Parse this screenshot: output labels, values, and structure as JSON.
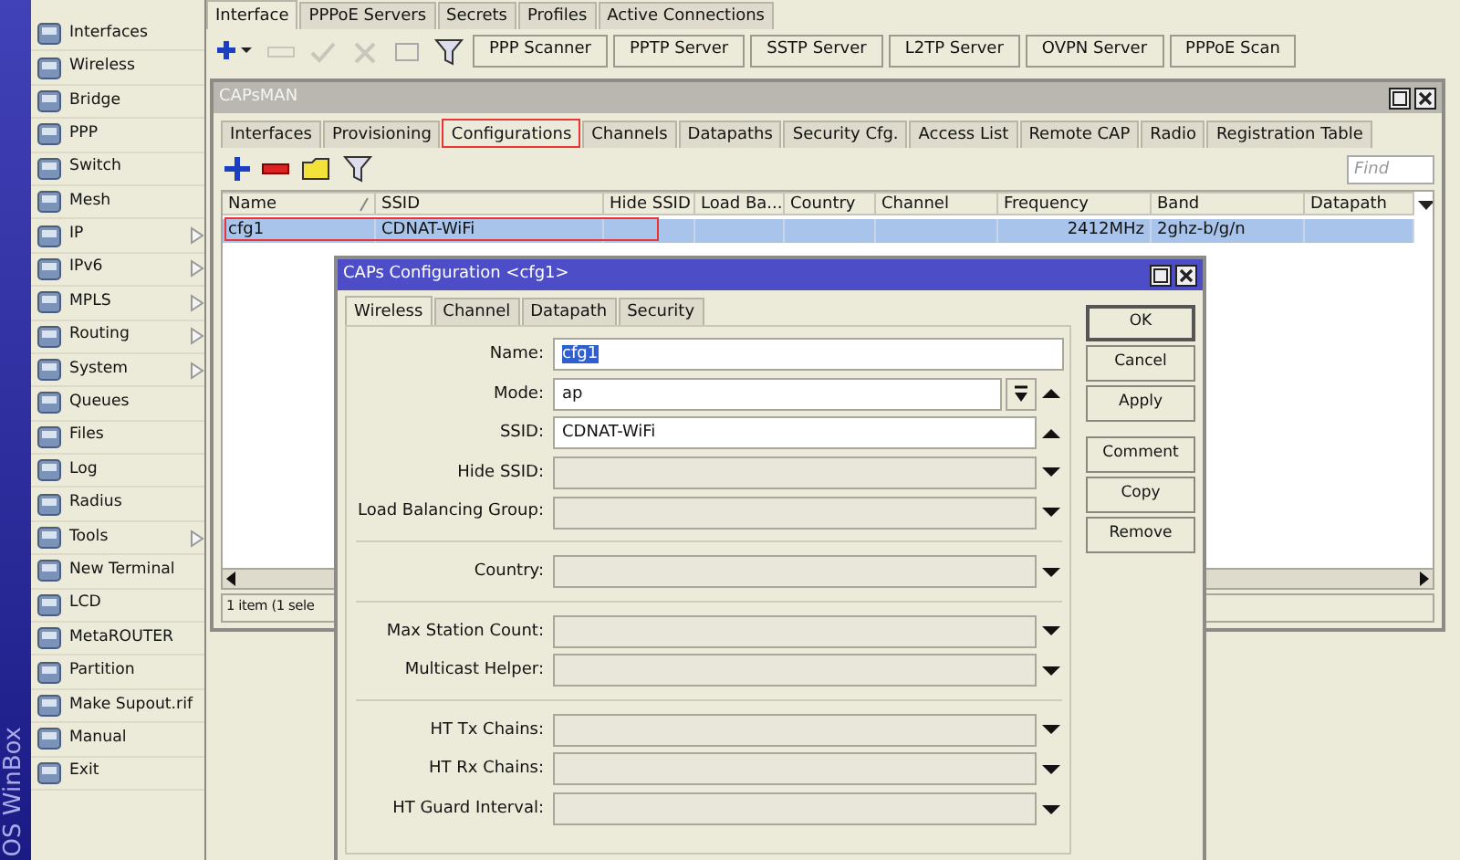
{
  "side_strip": {
    "label": "OS WinBox"
  },
  "sidebar": {
    "items": [
      {
        "label": "Interfaces",
        "submenu": false
      },
      {
        "label": "Wireless",
        "submenu": false
      },
      {
        "label": "Bridge",
        "submenu": false
      },
      {
        "label": "PPP",
        "submenu": false
      },
      {
        "label": "Switch",
        "submenu": false
      },
      {
        "label": "Mesh",
        "submenu": false
      },
      {
        "label": "IP",
        "submenu": true
      },
      {
        "label": "IPv6",
        "submenu": true
      },
      {
        "label": "MPLS",
        "submenu": true
      },
      {
        "label": "Routing",
        "submenu": true
      },
      {
        "label": "System",
        "submenu": true
      },
      {
        "label": "Queues",
        "submenu": false
      },
      {
        "label": "Files",
        "submenu": false
      },
      {
        "label": "Log",
        "submenu": false
      },
      {
        "label": "Radius",
        "submenu": false
      },
      {
        "label": "Tools",
        "submenu": true
      },
      {
        "label": "New Terminal",
        "submenu": false
      },
      {
        "label": "LCD",
        "submenu": false
      },
      {
        "label": "MetaROUTER",
        "submenu": false
      },
      {
        "label": "Partition",
        "submenu": false
      },
      {
        "label": "Make Supout.rif",
        "submenu": false
      },
      {
        "label": "Manual",
        "submenu": false
      },
      {
        "label": "Exit",
        "submenu": false
      }
    ]
  },
  "ppp_window": {
    "tabs": [
      {
        "label": "Interface",
        "selected": true
      },
      {
        "label": "PPPoE Servers",
        "selected": false
      },
      {
        "label": "Secrets",
        "selected": false
      },
      {
        "label": "Profiles",
        "selected": false
      },
      {
        "label": "Active Connections",
        "selected": false
      }
    ],
    "toolbar_buttons": [
      "PPP Scanner",
      "PPTP Server",
      "SSTP Server",
      "L2TP Server",
      "OVPN Server",
      "PPPoE Scan"
    ]
  },
  "capsman_window": {
    "title": "CAPsMAN",
    "tabs": [
      {
        "label": "Interfaces",
        "selected": false,
        "highlighted": false
      },
      {
        "label": "Provisioning",
        "selected": false,
        "highlighted": false
      },
      {
        "label": "Configurations",
        "selected": true,
        "highlighted": true
      },
      {
        "label": "Channels",
        "selected": false,
        "highlighted": false
      },
      {
        "label": "Datapaths",
        "selected": false,
        "highlighted": false
      },
      {
        "label": "Security Cfg.",
        "selected": false,
        "highlighted": false
      },
      {
        "label": "Access List",
        "selected": false,
        "highlighted": false
      },
      {
        "label": "Remote CAP",
        "selected": false,
        "highlighted": false
      },
      {
        "label": "Radio",
        "selected": false,
        "highlighted": false
      },
      {
        "label": "Registration Table",
        "selected": false,
        "highlighted": false
      }
    ],
    "find": {
      "placeholder": "Find"
    },
    "table": {
      "columns": [
        "Name",
        "SSID",
        "Hide SSID",
        "Load Ba...",
        "Country",
        "Channel",
        "Frequency",
        "Band",
        "Datapath"
      ],
      "rows": [
        {
          "cells": [
            "cfg1",
            "CDNAT-WiFi",
            "",
            "",
            "",
            "",
            "2412MHz",
            "2ghz-b/g/n",
            ""
          ],
          "selected": true,
          "highlighted": true
        }
      ]
    },
    "status": "1 item (1 sele"
  },
  "dialog": {
    "title": "CAPs Configuration <cfg1>",
    "tabs": [
      {
        "label": "Wireless",
        "selected": true
      },
      {
        "label": "Channel",
        "selected": false
      },
      {
        "label": "Datapath",
        "selected": false
      },
      {
        "label": "Security",
        "selected": false
      }
    ],
    "sections": [
      [
        {
          "label": "Name:",
          "kind": "text",
          "value": "cfg1",
          "removable": false,
          "text_selected": true
        },
        {
          "label": "Mode:",
          "kind": "combo",
          "value": "ap",
          "removable": true,
          "text_selected": false
        },
        {
          "label": "SSID:",
          "kind": "text",
          "value": "CDNAT-WiFi",
          "removable": true,
          "text_selected": false
        },
        {
          "label": "Hide SSID:",
          "kind": "unset"
        },
        {
          "label": "Load Balancing Group:",
          "kind": "unset"
        }
      ],
      [
        {
          "label": "Country:",
          "kind": "unset"
        }
      ],
      [
        {
          "label": "Max Station Count:",
          "kind": "unset"
        },
        {
          "label": "Multicast Helper:",
          "kind": "unset"
        }
      ],
      [
        {
          "label": "HT Tx Chains:",
          "kind": "unset"
        },
        {
          "label": "HT Rx Chains:",
          "kind": "unset"
        },
        {
          "label": "HT Guard Interval:",
          "kind": "unset"
        }
      ]
    ],
    "button_groups": [
      [
        {
          "label": "OK",
          "default": true
        },
        {
          "label": "Cancel",
          "default": false
        },
        {
          "label": "Apply",
          "default": false
        }
      ],
      [
        {
          "label": "Comment",
          "default": false
        },
        {
          "label": "Copy",
          "default": false
        },
        {
          "label": "Remove",
          "default": false
        }
      ]
    ]
  }
}
